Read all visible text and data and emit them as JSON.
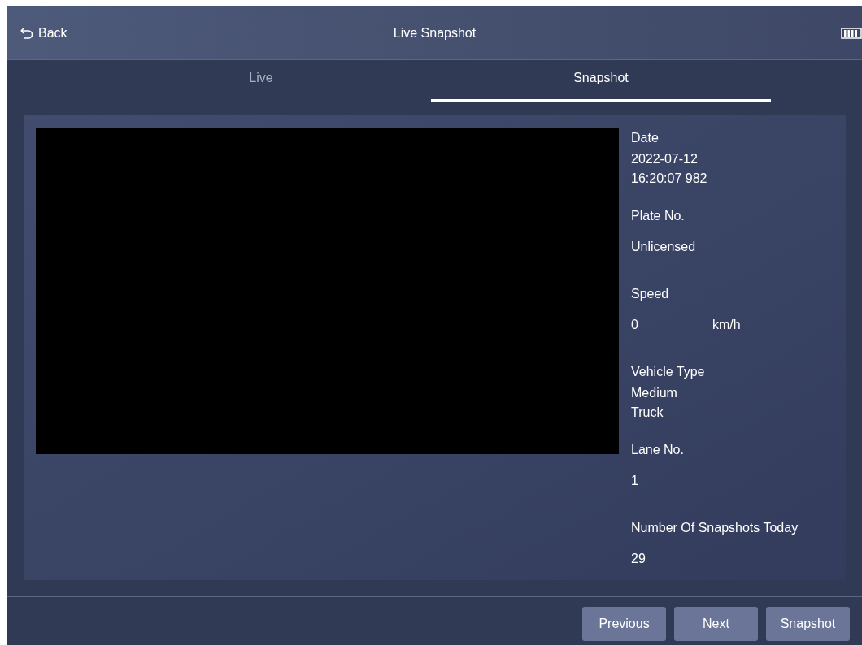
{
  "header": {
    "back": "Back",
    "title": "Live Snapshot"
  },
  "tabs": [
    {
      "label": "Live",
      "selected": false
    },
    {
      "label": "Snapshot",
      "selected": true
    }
  ],
  "fields": [
    {
      "label": "Date",
      "value": "2022-07-12 16:20:07 982"
    },
    {
      "label": "Plate No.",
      "value": "Unlicensed"
    },
    {
      "label": "Speed",
      "value": "0",
      "unit": "km/h"
    },
    {
      "label": "Vehicle Type",
      "value": "Medium Truck"
    },
    {
      "label": "Lane No.",
      "value": "1"
    },
    {
      "label": "Number Of Snapshots Today",
      "value": "29"
    }
  ],
  "buttons": [
    "Previous",
    "Next",
    "Snapshot"
  ]
}
